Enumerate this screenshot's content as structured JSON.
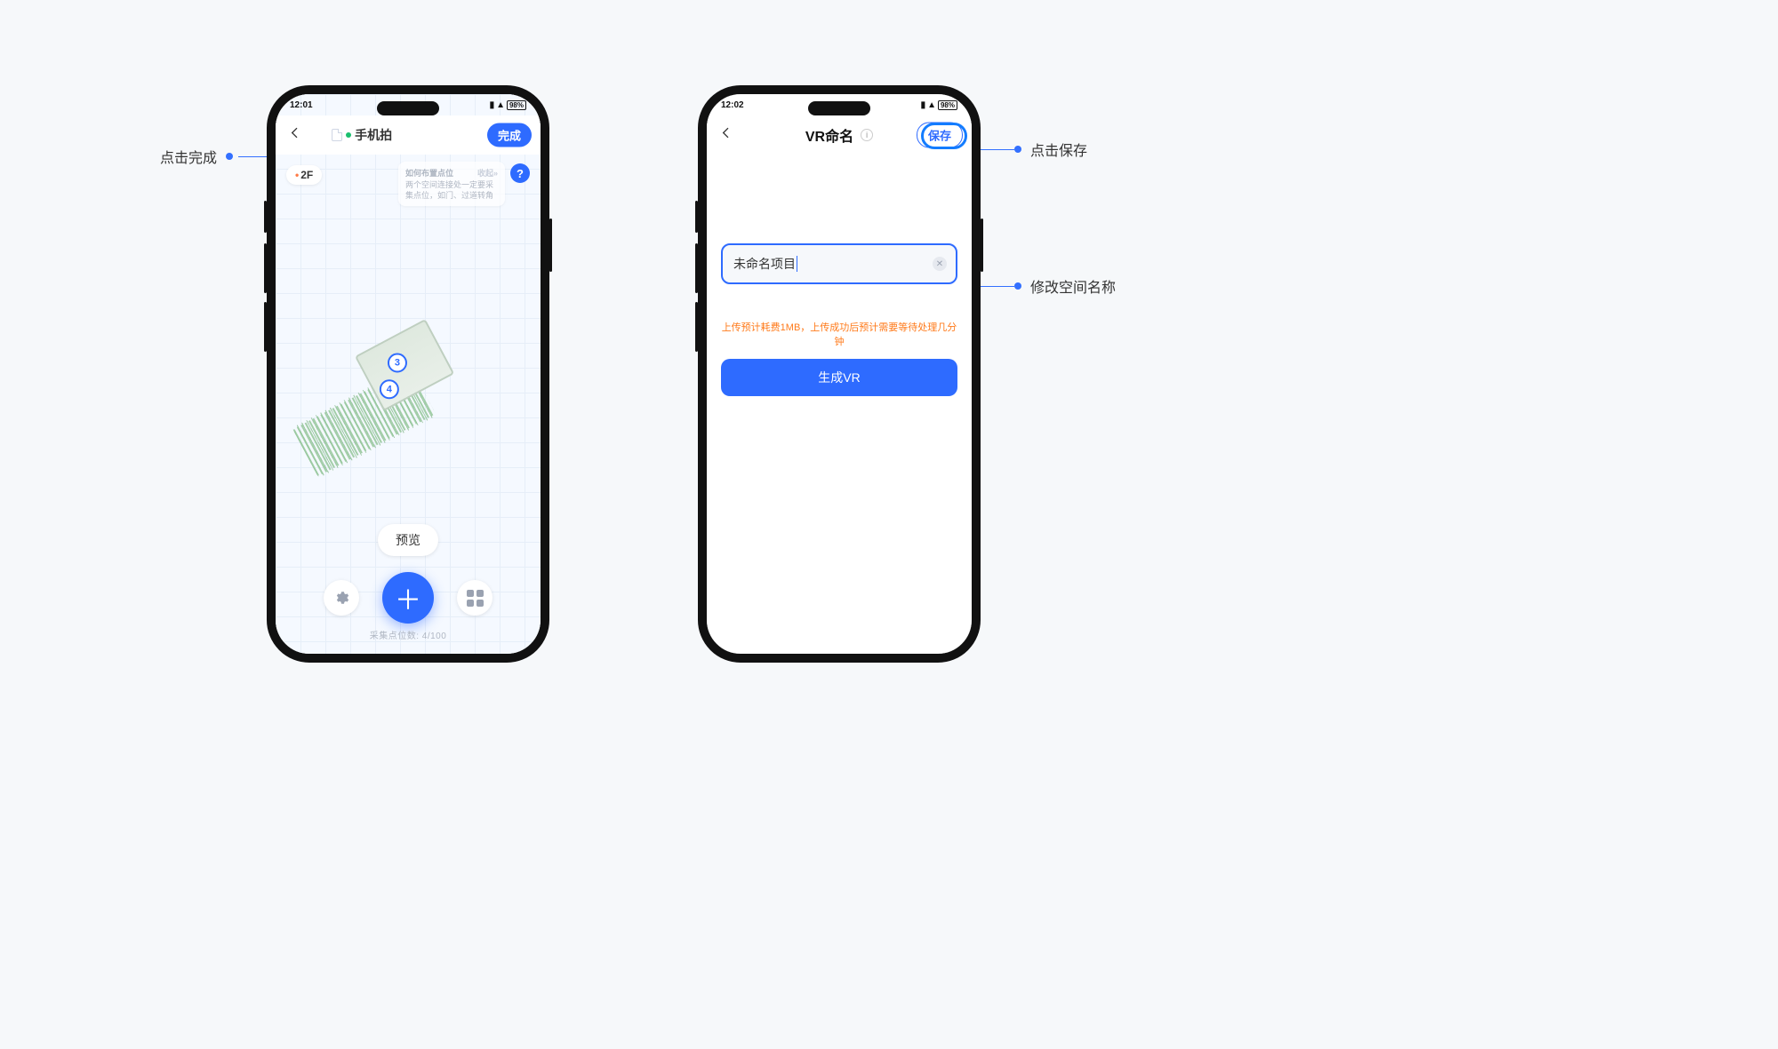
{
  "colors": {
    "accent": "#2e6bff",
    "warn": "#ff7a1a"
  },
  "callout_left": "点击完成",
  "callout_save": "点击保存",
  "callout_name": "修改空间名称",
  "left": {
    "status_time": "12:01",
    "status_right": "98%",
    "title": "手机拍",
    "done": "完成",
    "floor": "2F",
    "hint_title": "如何布置点位",
    "hint_link": "收起»",
    "hint_body": "两个空间连接处一定要采集点位，如门、过道转角",
    "help": "?",
    "preview": "预览",
    "count_label": "采集点位数:  4/100",
    "pt3": "3",
    "pt4": "4"
  },
  "right": {
    "status_time": "12:02",
    "status_right": "98%",
    "title": "VR命名",
    "save": "保存",
    "name_value": "未命名项目",
    "upload_hint": "上传预计耗费1MB，上传成功后预计需要等待处理几分钟",
    "generate": "生成VR"
  }
}
